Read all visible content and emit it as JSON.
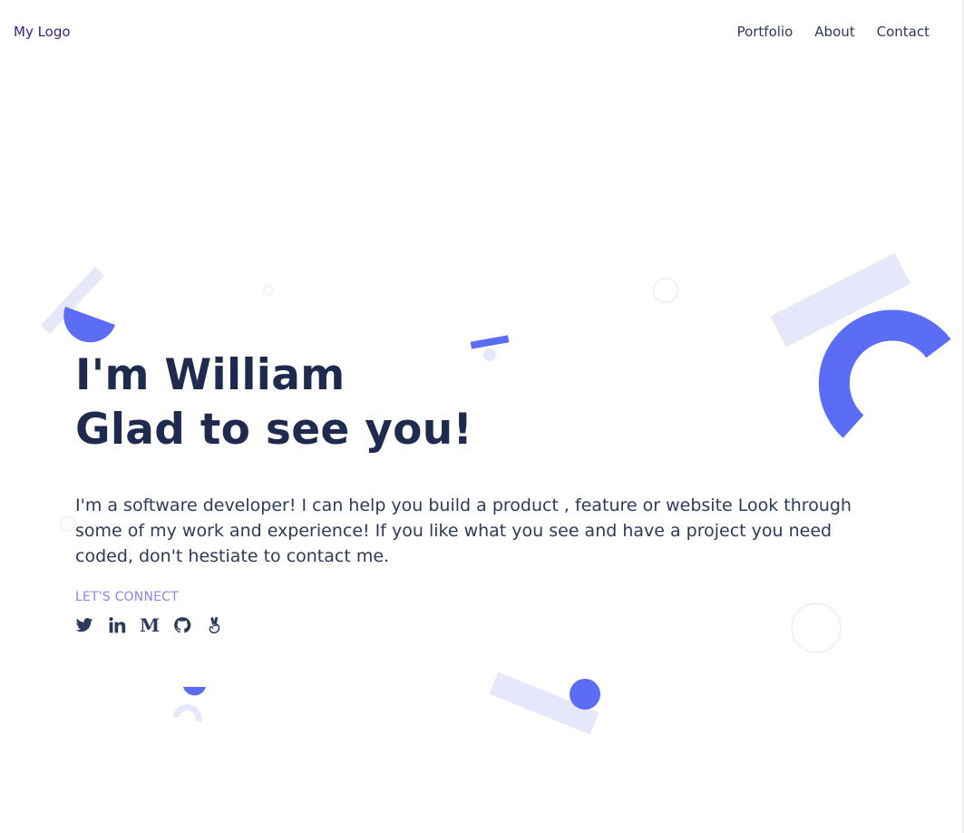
{
  "header": {
    "logo": "My Logo",
    "nav": {
      "portfolio": "Portfolio",
      "about": "About",
      "contact": "Contact"
    }
  },
  "hero": {
    "title_line1": "I'm William",
    "title_line2": "Glad to see you!",
    "description": "I'm a software developer! I can help you build a product , feature or website Look through some of my work and experience! If you like what you see and have a project you need coded, don't hestiate to contact me.",
    "connect_label": "LET'S CONNECT"
  },
  "socials": [
    {
      "icon": "twitter-icon"
    },
    {
      "icon": "linkedin-icon"
    },
    {
      "icon": "medium-icon",
      "glyph": "M"
    },
    {
      "icon": "github-icon"
    },
    {
      "icon": "angellist-icon"
    }
  ],
  "colors": {
    "accent": "#5b6cf5",
    "accent_light": "#e6e7fb",
    "heading": "#1e2b4f",
    "text": "#2e3a59",
    "connect_label": "#8c84f0",
    "logo": "#3b1f78"
  }
}
